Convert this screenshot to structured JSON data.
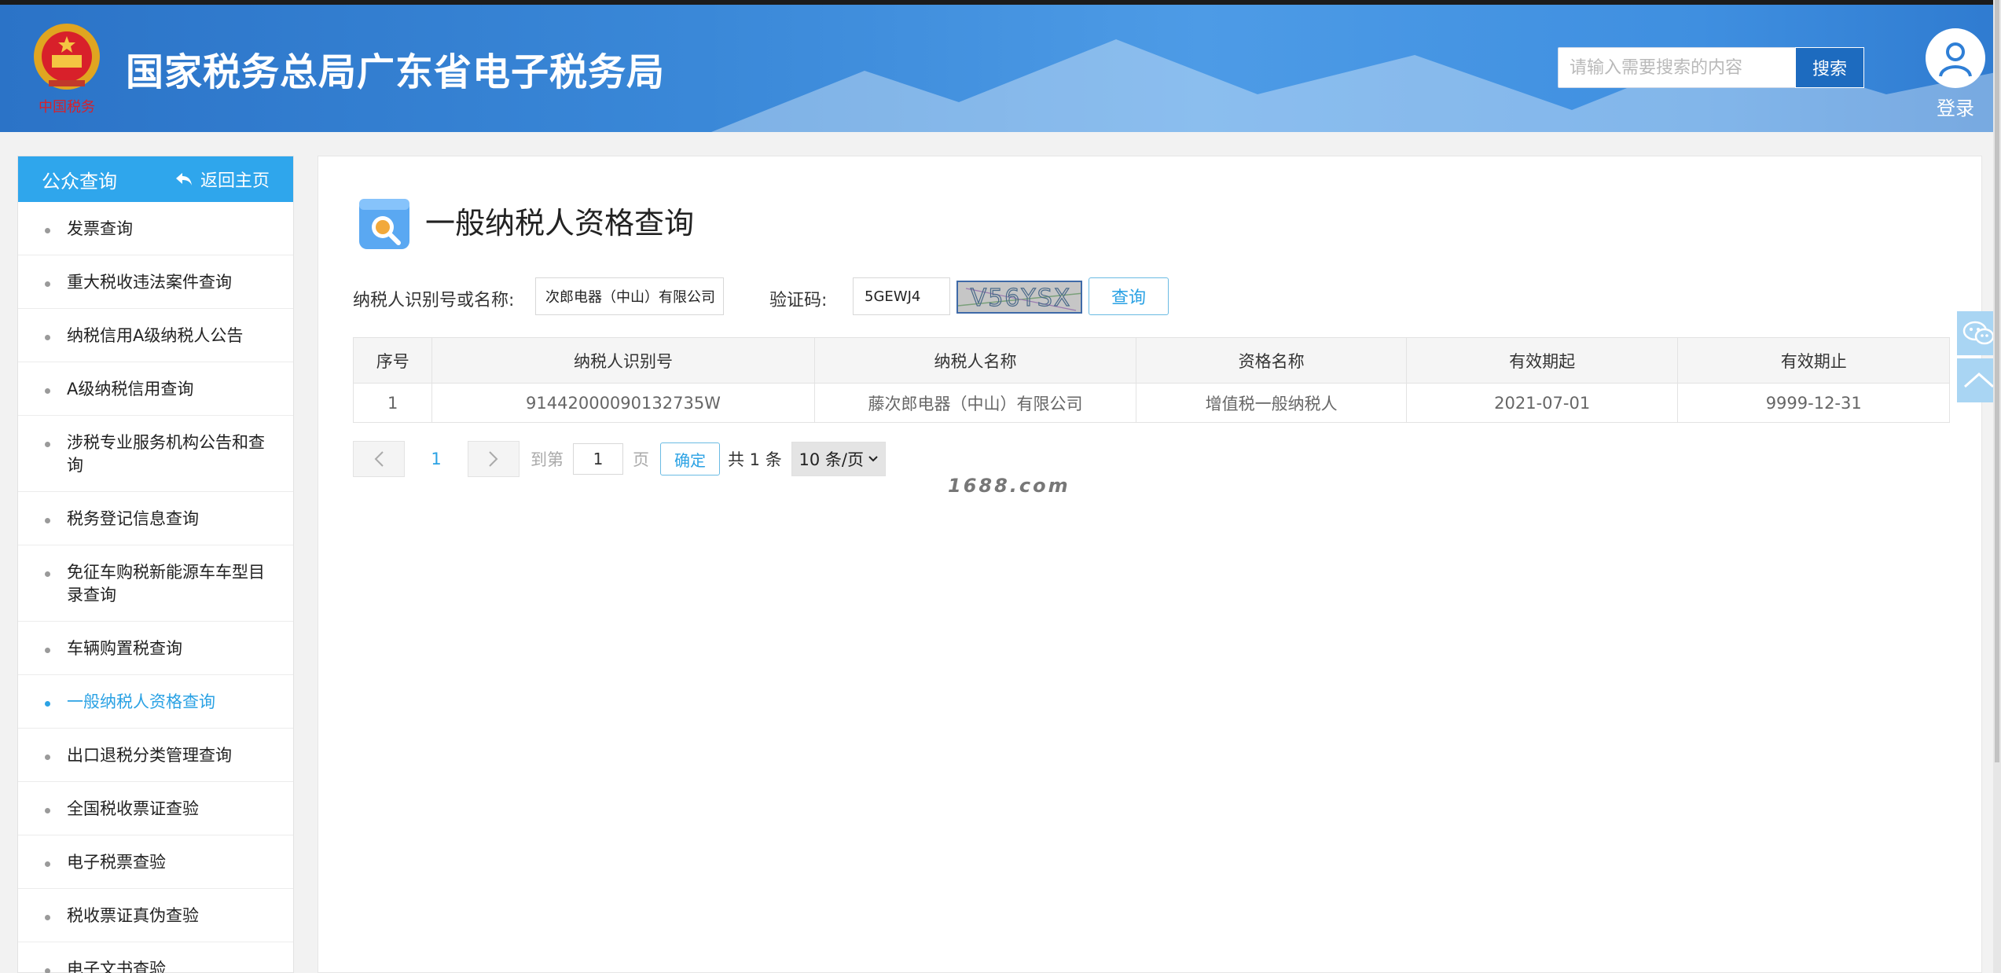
{
  "header": {
    "site_title": "国家税务总局广东省电子税务局",
    "search_placeholder": "请输入需要搜索的内容",
    "search_button": "搜索",
    "login_label": "登录",
    "emblem_caption": "中国税务"
  },
  "sidebar": {
    "title": "公众查询",
    "back_label": "返回主页",
    "items": [
      {
        "label": "发票查询"
      },
      {
        "label": "重大税收违法案件查询"
      },
      {
        "label": "纳税信用A级纳税人公告"
      },
      {
        "label": "A级纳税信用查询"
      },
      {
        "label": "涉税专业服务机构公告和查询"
      },
      {
        "label": "税务登记信息查询"
      },
      {
        "label": "免征车购税新能源车车型目录查询"
      },
      {
        "label": "车辆购置税查询"
      },
      {
        "label": "一般纳税人资格查询",
        "active": true
      },
      {
        "label": "出口退税分类管理查询"
      },
      {
        "label": "全国税收票证查验"
      },
      {
        "label": "电子税票查验"
      },
      {
        "label": "税收票证真伪查验"
      },
      {
        "label": "电子文书查验"
      }
    ]
  },
  "main": {
    "page_title": "一般纳税人资格查询",
    "query": {
      "taxpayer_label": "纳税人识别号或名称:",
      "taxpayer_value": "次郎电器（中山）有限公司",
      "captcha_label": "验证码:",
      "captcha_value": "5GEWJ4",
      "captcha_image_text": "V56YSX",
      "submit": "查询"
    },
    "table": {
      "columns": [
        "序号",
        "纳税人识别号",
        "纳税人名称",
        "资格名称",
        "有效期起",
        "有效期止"
      ],
      "rows": [
        [
          "1",
          "91442000090132735W",
          "藤次郎电器（中山）有限公司",
          "增值税一般纳税人",
          "2021-07-01",
          "9999-12-31"
        ]
      ]
    },
    "pager": {
      "current_page": "1",
      "goto_label": "到第",
      "goto_value": "1",
      "page_unit": "页",
      "confirm": "确定",
      "total": "共 1 条",
      "page_size": "10 条/页"
    },
    "watermark": "1688.com"
  },
  "colors": {
    "header_blue": "#3a88d8",
    "sidebar_head": "#2fa6ec",
    "accent": "#2ba2e4"
  },
  "icons": [
    "emblem-icon",
    "user-icon",
    "back-arrow-icon",
    "search-page-icon",
    "chevron-left-icon",
    "chevron-right-icon",
    "chevron-down-icon",
    "wechat-icon",
    "back-to-top-icon"
  ]
}
